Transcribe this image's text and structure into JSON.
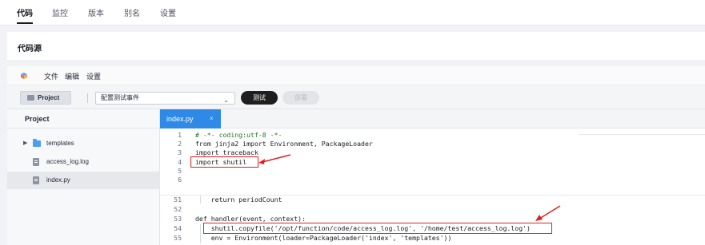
{
  "top_tabs": [
    {
      "label": "代码",
      "active": true
    },
    {
      "label": "监控",
      "active": false
    },
    {
      "label": "版本",
      "active": false
    },
    {
      "label": "别名",
      "active": false
    },
    {
      "label": "设置",
      "active": false
    }
  ],
  "code_source": {
    "title": "代码源"
  },
  "ide_menu": [
    "文件",
    "编辑",
    "设置"
  ],
  "toolbar": {
    "project_label": "Project",
    "event_select_value": "配置测试事件",
    "test_label": "测试",
    "deploy_label": "部署"
  },
  "explorer": {
    "title": "Project",
    "items": [
      {
        "label": "templates",
        "type": "folder",
        "expandable": true
      },
      {
        "label": "access_log.log",
        "type": "file"
      },
      {
        "label": "index.py",
        "type": "file",
        "selected": true
      }
    ]
  },
  "editor": {
    "tab_label": "index.py",
    "tab_close": "×",
    "lines_top": [
      {
        "n": "1",
        "text": "# -*- coding:utf-8 -*-"
      },
      {
        "n": "2",
        "text": "from jinja2 import Environment, PackageLoader"
      },
      {
        "n": "3",
        "text": "import traceback"
      },
      {
        "n": "4",
        "text": "import shutil"
      },
      {
        "n": "5",
        "text": ""
      },
      {
        "n": "6",
        "text": ""
      }
    ],
    "lines_bottom": [
      {
        "n": "51",
        "text": "    return periodCount"
      },
      {
        "n": "52",
        "text": ""
      },
      {
        "n": "53",
        "text": "def handler(event, context):"
      },
      {
        "n": "54",
        "text": "    shutil.copyfile('/opt/function/code/access_log.log', '/home/test/access_log.log')"
      },
      {
        "n": "55",
        "text": "    env = Environment(loader=PackageLoader('index', 'templates'))"
      }
    ]
  },
  "colors": {
    "accent": "#2e8ae6",
    "annotation": "#e02020",
    "primary_button": "#1f1f1f"
  }
}
